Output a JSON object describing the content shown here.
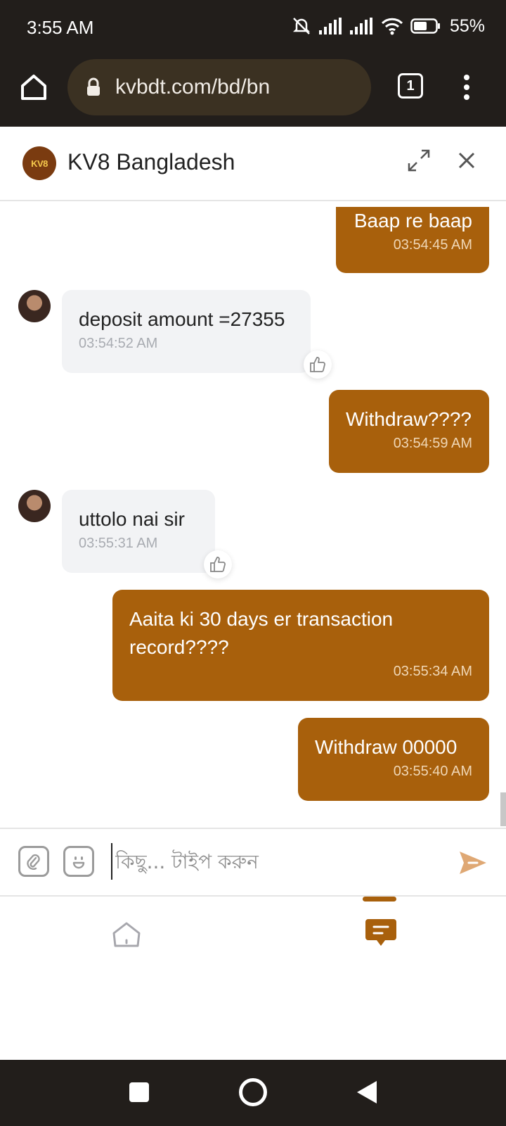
{
  "status_bar": {
    "time": "3:55 AM",
    "battery": "55%"
  },
  "browser": {
    "url": "kvbdt.com/bd/bn",
    "tab_count": "1"
  },
  "chat_header": {
    "logo_text": "KV8",
    "title": "KV8 Bangladesh"
  },
  "messages": [
    {
      "from": "user",
      "text": "Baap re baap",
      "time": "03:54:45 AM"
    },
    {
      "from": "agent",
      "text": "deposit amount =27355",
      "time": "03:54:52 AM"
    },
    {
      "from": "user",
      "text": "Withdraw????",
      "time": "03:54:59 AM"
    },
    {
      "from": "agent",
      "text": "uttolo nai sir",
      "time": "03:55:31 AM"
    },
    {
      "from": "user",
      "text": "Aaita ki 30 days er transaction record????",
      "time": "03:55:34 AM"
    },
    {
      "from": "user",
      "text": "Withdraw 00000",
      "time": "03:55:40 AM"
    }
  ],
  "input": {
    "placeholder": "কিছু... টাইপ করুন"
  },
  "colors": {
    "brand": "#a8600c",
    "dark_bar": "#221e1b",
    "agent_bubble": "#f2f3f5"
  },
  "icons": {
    "attach": "attachment-icon",
    "emoji": "emoji-icon",
    "send": "send-icon",
    "home_tab": "home-icon",
    "chat_tab": "chat-icon",
    "like": "thumbs-up-icon"
  }
}
